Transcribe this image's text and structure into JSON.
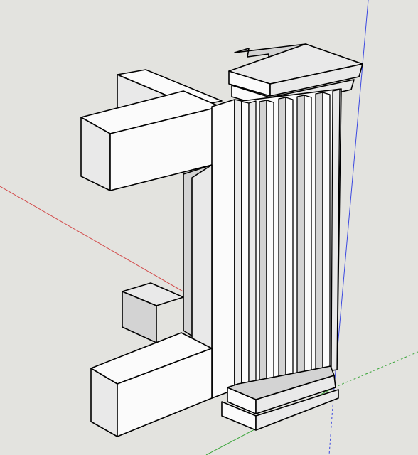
{
  "app": {
    "viewport_label": ""
  },
  "scene": {
    "background": "#e3e3df",
    "edge_color": "#000000",
    "axis_colors": {
      "red": "#d24a4a",
      "green": "#3aa53a",
      "blue": "#3b48e0"
    },
    "face_colors": {
      "light": "#fbfbfb",
      "mid": "#e9e9e9",
      "shade": "#d3d3d3",
      "dark": "#bdbdbd"
    },
    "objects": [
      "c-bracket-model",
      "fluted-pilaster-column"
    ]
  }
}
